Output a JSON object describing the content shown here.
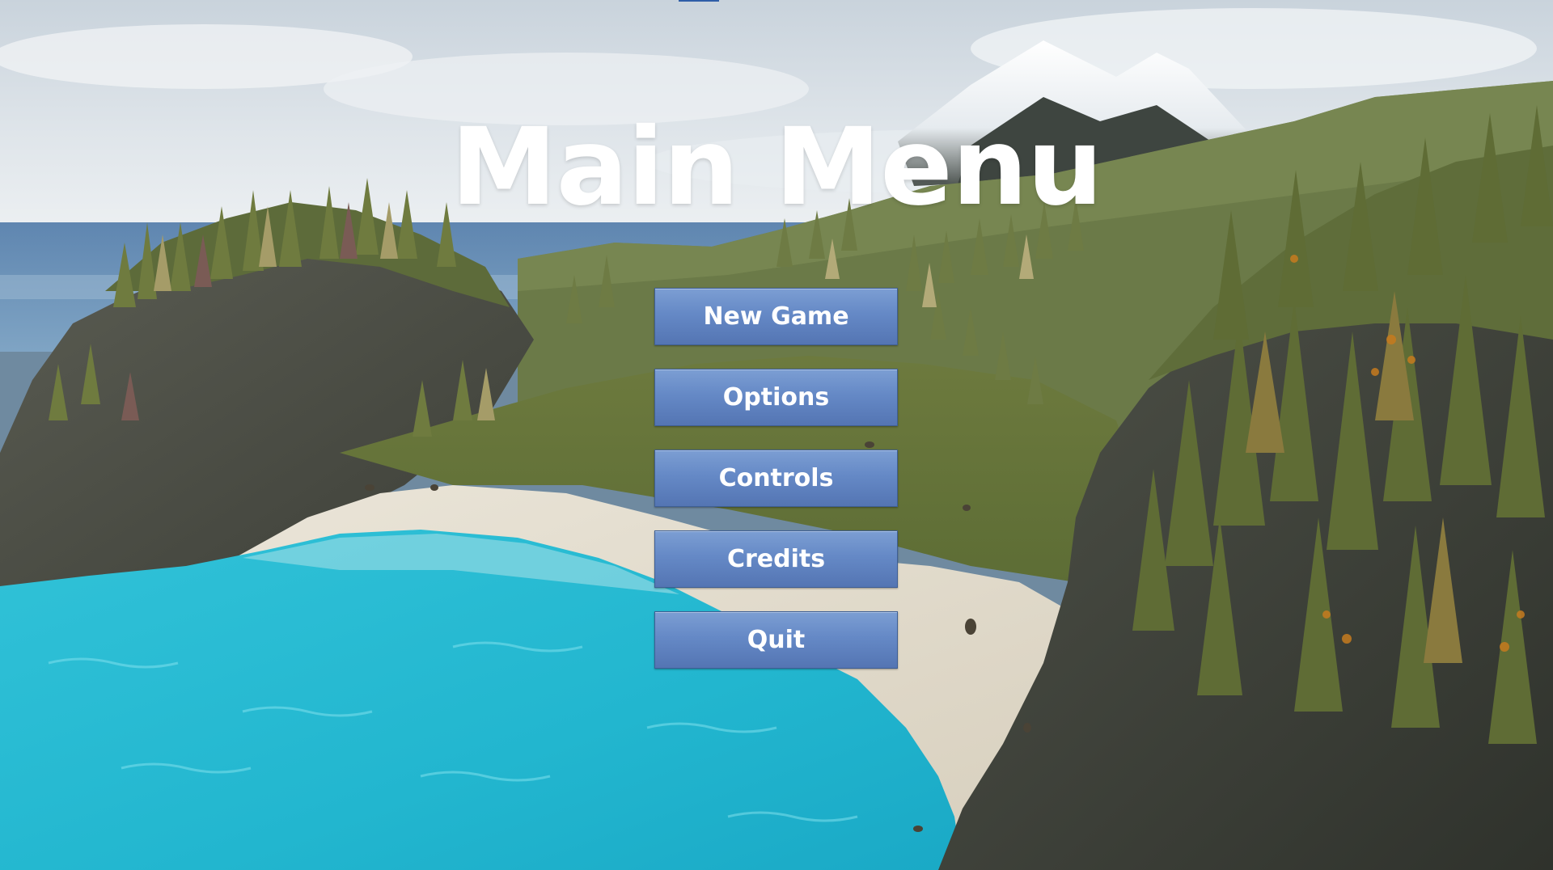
{
  "screen": {
    "title": "Main Menu"
  },
  "menu": {
    "items": [
      {
        "label": "New Game",
        "name": "new-game-button"
      },
      {
        "label": "Options",
        "name": "options-button"
      },
      {
        "label": "Controls",
        "name": "controls-button"
      },
      {
        "label": "Credits",
        "name": "credits-button"
      },
      {
        "label": "Quit",
        "name": "quit-button"
      }
    ]
  },
  "colors": {
    "button_fill": "#6589c6",
    "button_border": "#3e5f94",
    "title_text": "#ffffff",
    "water": "#2ec3d6",
    "sand": "#e2dccf",
    "forest": "#5a6a3a"
  },
  "icons": [
    "snow-mountain-background",
    "island-landscape-background"
  ]
}
